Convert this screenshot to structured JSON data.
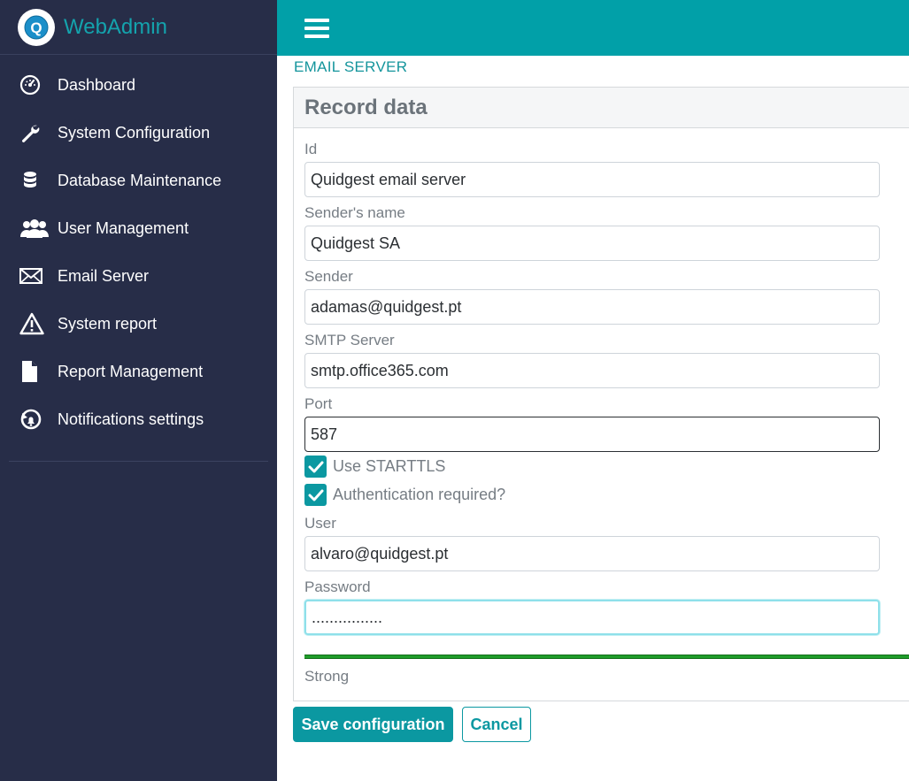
{
  "brand": {
    "title": "WebAdmin",
    "logo_letter": "Q"
  },
  "sidebar": {
    "items": [
      {
        "label": "Dashboard",
        "icon": "dashboard-icon"
      },
      {
        "label": "System Configuration",
        "icon": "wrench-icon"
      },
      {
        "label": "Database Maintenance",
        "icon": "database-icon"
      },
      {
        "label": "User Management",
        "icon": "users-icon"
      },
      {
        "label": "Email Server",
        "icon": "envelope-icon"
      },
      {
        "label": "System report",
        "icon": "warning-icon"
      },
      {
        "label": "Report Management",
        "icon": "file-icon"
      },
      {
        "label": "Notifications settings",
        "icon": "notification-refresh-icon"
      }
    ]
  },
  "topbar": {
    "menu_icon": "hamburger-icon"
  },
  "page": {
    "title": "EMAIL SERVER"
  },
  "panel": {
    "title": "Record data"
  },
  "form": {
    "id": {
      "label": "Id",
      "value": "Quidgest email server"
    },
    "sender_name": {
      "label": "Sender's name",
      "value": "Quidgest SA"
    },
    "sender": {
      "label": "Sender",
      "value": "adamas@quidgest.pt"
    },
    "smtp": {
      "label": "SMTP Server",
      "value": "smtp.office365.com"
    },
    "port": {
      "label": "Port",
      "value": "587"
    },
    "starttls": {
      "label": "Use STARTTLS",
      "checked": true
    },
    "auth": {
      "label": "Authentication required?",
      "checked": true
    },
    "user": {
      "label": "User",
      "value": "alvaro@quidgest.pt"
    },
    "password": {
      "label": "Password",
      "value": "................"
    },
    "strength": {
      "label": "Strong",
      "color": "#1f9d2a"
    }
  },
  "actions": {
    "save_label": "Save configuration",
    "cancel_label": "Cancel"
  },
  "colors": {
    "accent": "#0b98a1",
    "sidebar_bg": "#272d48",
    "topbar_bg": "#01a0a8"
  }
}
